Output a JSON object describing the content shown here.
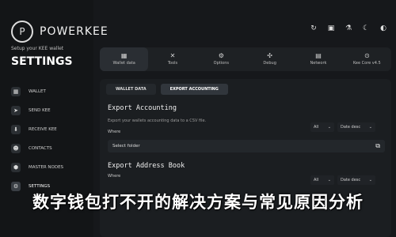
{
  "brand": {
    "name": "POWERKEE",
    "logo_glyph": "P"
  },
  "sidebar": {
    "setup_text": "Setup your KEE wallet",
    "settings_title": "SETTINGS",
    "items": [
      {
        "label": "WALLET",
        "icon": "wallet-icon",
        "glyph": "▦"
      },
      {
        "label": "SEND KEE",
        "icon": "send-icon",
        "glyph": "➤"
      },
      {
        "label": "RECEIVE KEE",
        "icon": "receive-icon",
        "glyph": "⬇"
      },
      {
        "label": "CONTACTS",
        "icon": "contacts-icon",
        "glyph": "☻"
      },
      {
        "label": "MASTER NODES",
        "icon": "master-nodes-icon",
        "glyph": "⬢"
      },
      {
        "label": "SETTINGS",
        "icon": "gear-icon",
        "glyph": "⚙"
      }
    ]
  },
  "top_icons": [
    {
      "name": "refresh-icon",
      "glyph": "↻"
    },
    {
      "name": "gift-icon",
      "glyph": "▣"
    },
    {
      "name": "flask-icon",
      "glyph": "⚗"
    },
    {
      "name": "moon-icon",
      "glyph": "☾"
    },
    {
      "name": "theme-icon",
      "glyph": "◐"
    }
  ],
  "tabs": [
    {
      "label": "Wallet data",
      "glyph": "▦"
    },
    {
      "label": "Tools",
      "glyph": "✕"
    },
    {
      "label": "Options",
      "glyph": "⚙"
    },
    {
      "label": "Debug",
      "glyph": "✣"
    },
    {
      "label": "Network",
      "glyph": "▤"
    },
    {
      "label": "Kee Core v4.5",
      "glyph": "⊙"
    }
  ],
  "subtabs": [
    {
      "label": "WALLET DATA"
    },
    {
      "label": "EXPORT ACCOUNTING"
    }
  ],
  "export_accounting": {
    "title": "Export Accounting",
    "description": "Export your wallets accounting data to a CSV file.",
    "where_label": "Where",
    "filter_all": "All",
    "filter_sort": "Date desc",
    "folder_placeholder": "Select folder"
  },
  "export_address_book": {
    "title": "Export Address Book",
    "where_label": "Where",
    "filter_all": "All",
    "filter_sort": "Date desc"
  },
  "banner_text": "数字钱包打不开的解决方案与常见原因分析"
}
